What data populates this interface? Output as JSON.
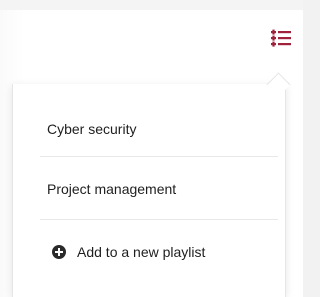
{
  "header": {
    "playlist_icon": "playlist-add-icon",
    "accent_color": "#a0223a"
  },
  "dropdown": {
    "items": [
      {
        "label": "Cyber security"
      },
      {
        "label": "Project management"
      }
    ],
    "add_new": {
      "label": "Add to a new playlist",
      "icon": "plus-circle-icon"
    }
  }
}
